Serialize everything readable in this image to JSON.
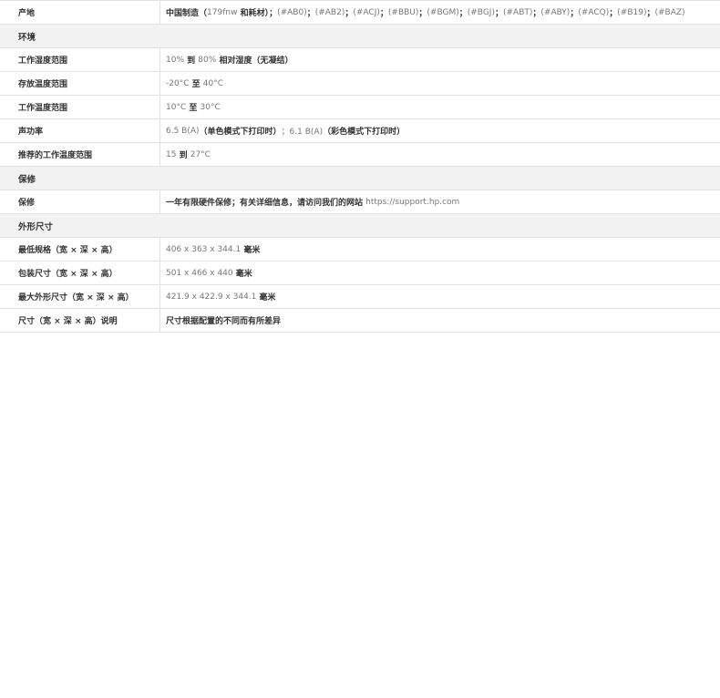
{
  "rows": [
    {
      "type": "row",
      "label": "产地",
      "parts": [
        {
          "t": "中国制造（",
          "bold": true
        },
        {
          "t": "179fnw",
          "bold": false
        },
        {
          "t": " 和耗材）；",
          "bold": true
        },
        {
          "t": "(#AB0)",
          "bold": false
        },
        {
          "t": "；",
          "bold": true
        },
        {
          "t": "(#AB2)",
          "bold": false
        },
        {
          "t": "；",
          "bold": true
        },
        {
          "t": "(#ACJ)",
          "bold": false
        },
        {
          "t": "；",
          "bold": true
        },
        {
          "t": "(#BBU)",
          "bold": false
        },
        {
          "t": "；",
          "bold": true
        },
        {
          "t": "(#BGM)",
          "bold": false
        },
        {
          "t": "；",
          "bold": true
        },
        {
          "t": "(#BGJ)",
          "bold": false
        },
        {
          "t": "；",
          "bold": true
        },
        {
          "t": "(#ABT)",
          "bold": false
        },
        {
          "t": "；",
          "bold": true
        },
        {
          "t": "(#ABY)",
          "bold": false
        },
        {
          "t": "；",
          "bold": true
        },
        {
          "t": "(#ACQ)",
          "bold": false
        },
        {
          "t": "；",
          "bold": true
        },
        {
          "t": "(#B19)",
          "bold": false
        },
        {
          "t": "；",
          "bold": true
        },
        {
          "t": "(#BAZ)",
          "bold": false
        }
      ]
    },
    {
      "type": "section",
      "label": "环境"
    },
    {
      "type": "row",
      "label": "工作湿度范围",
      "parts": [
        {
          "t": "10%",
          "bold": false
        },
        {
          "t": " 到 ",
          "bold": true
        },
        {
          "t": "80%",
          "bold": false
        },
        {
          "t": " 相对湿度（无凝结）",
          "bold": true
        }
      ]
    },
    {
      "type": "row",
      "label": "存放温度范围",
      "parts": [
        {
          "t": "-20°C",
          "bold": false
        },
        {
          "t": " 至 ",
          "bold": true
        },
        {
          "t": "40°C",
          "bold": false
        }
      ]
    },
    {
      "type": "row",
      "label": "工作温度范围",
      "parts": [
        {
          "t": "10°C",
          "bold": false
        },
        {
          "t": " 至 ",
          "bold": true
        },
        {
          "t": "30°C",
          "bold": false
        }
      ]
    },
    {
      "type": "row",
      "label": "声功率",
      "parts": [
        {
          "t": "6.5 B(A)",
          "bold": false
        },
        {
          "t": "（单色模式下打印时）",
          "bold": true
        },
        {
          "t": "；6.1 B(A)",
          "bold": false
        },
        {
          "t": "（彩色模式下打印时）",
          "bold": true
        }
      ]
    },
    {
      "type": "row",
      "label": "推荐的工作温度范围",
      "parts": [
        {
          "t": "15",
          "bold": false
        },
        {
          "t": " 到 ",
          "bold": true
        },
        {
          "t": "27°C",
          "bold": false
        }
      ]
    },
    {
      "type": "section",
      "label": "保修"
    },
    {
      "type": "row",
      "label": "保修",
      "parts": [
        {
          "t": "一年有限硬件保修；有关详细信息，请访问我们的网站 ",
          "bold": true
        },
        {
          "t": "https://support.hp.com",
          "bold": false
        }
      ]
    },
    {
      "type": "section",
      "label": "外形尺寸"
    },
    {
      "type": "row",
      "label": "最低规格（宽 × 深 × 高）",
      "parts": [
        {
          "t": "406 x 363 x 344.1",
          "bold": false
        },
        {
          "t": " 毫米",
          "bold": true
        }
      ]
    },
    {
      "type": "row",
      "label": "包装尺寸（宽 × 深 × 高）",
      "parts": [
        {
          "t": "501 x 466 x 440",
          "bold": false
        },
        {
          "t": " 毫米",
          "bold": true
        }
      ]
    },
    {
      "type": "row",
      "label": "最大外形尺寸（宽 × 深 × 高）",
      "parts": [
        {
          "t": "421.9 x 422.9 x 344.1",
          "bold": false
        },
        {
          "t": " 毫米",
          "bold": true
        }
      ]
    },
    {
      "type": "row",
      "label": "尺寸（宽 × 深 × 高）说明",
      "parts": [
        {
          "t": "尺寸根据配置的不同而有所差异",
          "bold": true
        }
      ]
    }
  ]
}
